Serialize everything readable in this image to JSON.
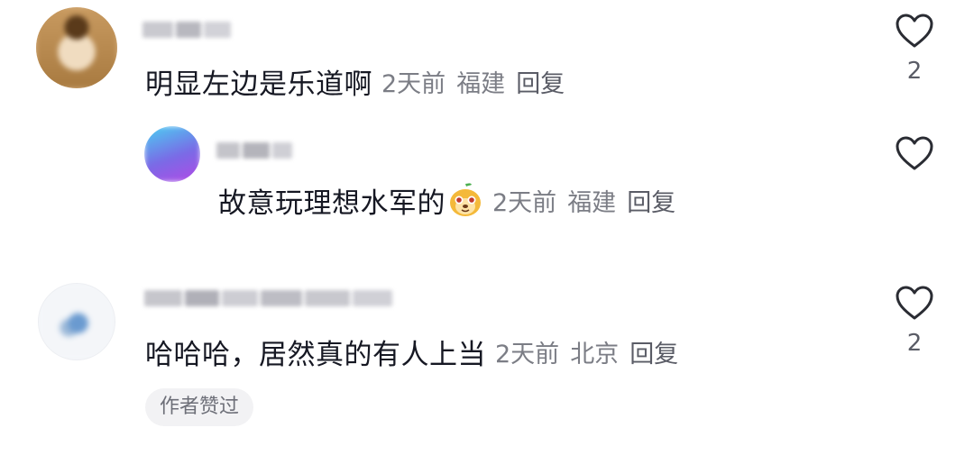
{
  "comments": [
    {
      "text": "明显左边是乐道啊",
      "time": "2天前",
      "location": "福建",
      "reply_label": "回复",
      "likes": "2",
      "avatar_colors": [
        "#c8a06a",
        "#8a6a3a",
        "#e8d0b0"
      ]
    },
    {
      "text": "故意玩理想水军的",
      "emoji": "cartoon-face-emoji",
      "time": "2天前",
      "location": "福建",
      "reply_label": "回复",
      "likes": "",
      "avatar_colors": [
        "#5ac8f0",
        "#8a5ae0",
        "#b04ae8"
      ]
    },
    {
      "text": "哈哈哈，居然真的有人上当",
      "time": "2天前",
      "location": "北京",
      "reply_label": "回复",
      "likes": "2",
      "avatar_colors": [
        "#e8eef5",
        "#6a9ad0",
        "#c0d0e0"
      ]
    }
  ],
  "author_liked_badge": "作者赞过",
  "icons": {
    "like": "heart-outline-icon"
  }
}
